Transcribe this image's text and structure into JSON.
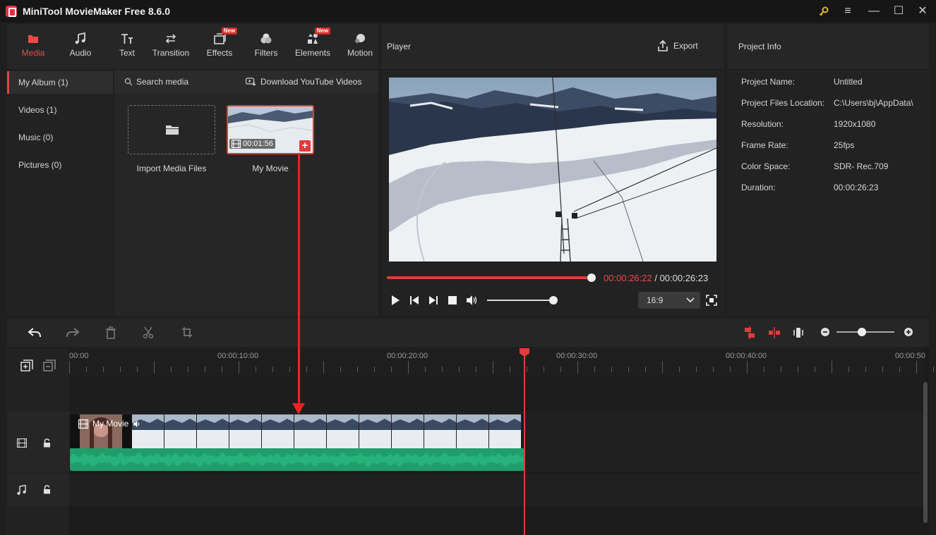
{
  "window": {
    "title": "MiniTool MovieMaker Free 8.6.0",
    "controls": [
      "key-icon",
      "menu-icon",
      "minimize-icon",
      "maximize-icon",
      "close-icon"
    ]
  },
  "toolbar": {
    "tabs": [
      {
        "label": "Media",
        "icon": "media-folder-icon",
        "active": true,
        "badge": ""
      },
      {
        "label": "Audio",
        "icon": "music-note-icon",
        "active": false,
        "badge": ""
      },
      {
        "label": "Text",
        "icon": "text-icon",
        "active": false,
        "badge": ""
      },
      {
        "label": "Transition",
        "icon": "transition-icon",
        "active": false,
        "badge": ""
      },
      {
        "label": "Effects",
        "icon": "effects-icon",
        "active": false,
        "badge": "New"
      },
      {
        "label": "Filters",
        "icon": "filters-icon",
        "active": false,
        "badge": ""
      },
      {
        "label": "Elements",
        "icon": "elements-icon",
        "active": false,
        "badge": "New"
      },
      {
        "label": "Motion",
        "icon": "motion-icon",
        "active": false,
        "badge": ""
      }
    ]
  },
  "sidebar": {
    "items": [
      {
        "label": "My Album (1)",
        "active": true
      },
      {
        "label": "Videos (1)",
        "active": false
      },
      {
        "label": "Music (0)",
        "active": false
      },
      {
        "label": "Pictures (0)",
        "active": false
      }
    ]
  },
  "media": {
    "search_placeholder": "Search media",
    "download_label": "Download YouTube Videos",
    "import_label": "Import Media Files",
    "item": {
      "name": "My Movie",
      "duration": "00:01:56"
    }
  },
  "player": {
    "title": "Player",
    "export_label": "Export",
    "current_time": "00:00:26:22",
    "separator": "/",
    "total_time": "00:00:26:23",
    "progress": 1.0,
    "volume": 1.0,
    "aspect_ratio": "16:9"
  },
  "project_info": {
    "title": "Project Info",
    "rows": [
      {
        "label": "Project Name:",
        "value": "Untitled"
      },
      {
        "label": "Project Files Location:",
        "value": "C:\\Users\\bj\\AppData\\"
      },
      {
        "label": "Resolution:",
        "value": "1920x1080"
      },
      {
        "label": "Frame Rate:",
        "value": "25fps"
      },
      {
        "label": "Color Space:",
        "value": "SDR- Rec.709"
      },
      {
        "label": "Duration:",
        "value": "00:00:26:23"
      }
    ]
  },
  "timeline": {
    "ruler_labels": [
      "00:00",
      "00:00:10:00",
      "00:00:20:00",
      "00:00:30:00",
      "00:00:40:00",
      "00:00:50"
    ],
    "clip_label": "My Movie",
    "zoom_level": 0.6
  },
  "colors": {
    "accent": "#e23b3b",
    "audio_wave": "#23a872",
    "panel": "#262626"
  }
}
